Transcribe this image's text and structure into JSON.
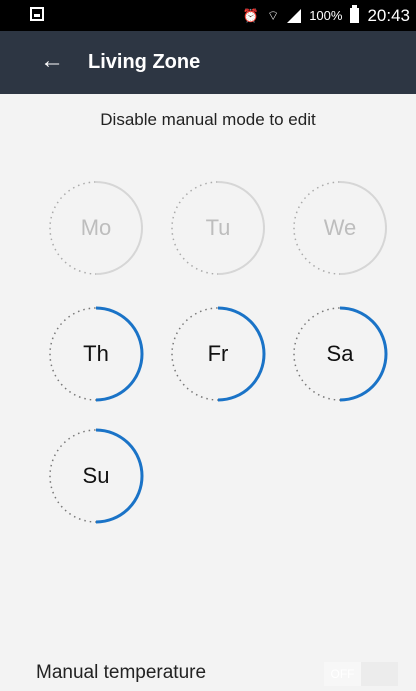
{
  "status_bar": {
    "battery_text": "100%",
    "time": "20:43",
    "icons": {
      "left": "sim-icon",
      "alarm": "alarm-icon",
      "wifi": "wifi-icon",
      "signal": "signal-icon",
      "battery": "battery-icon"
    }
  },
  "app_bar": {
    "title": "Living Zone",
    "back_icon": "arrow-left-icon",
    "background": "#2d3643"
  },
  "notice": "Disable manual mode to edit",
  "days": [
    {
      "label": "Mo",
      "enabled": false
    },
    {
      "label": "Tu",
      "enabled": false
    },
    {
      "label": "We",
      "enabled": false
    },
    {
      "label": "Th",
      "enabled": true
    },
    {
      "label": "Fr",
      "enabled": true
    },
    {
      "label": "Sa",
      "enabled": true
    },
    {
      "label": "Su",
      "enabled": true
    }
  ],
  "accent_color": "#1a73c7",
  "manual_temperature": {
    "label": "Manual temperature",
    "toggle_text": "OFF",
    "state": "off"
  }
}
